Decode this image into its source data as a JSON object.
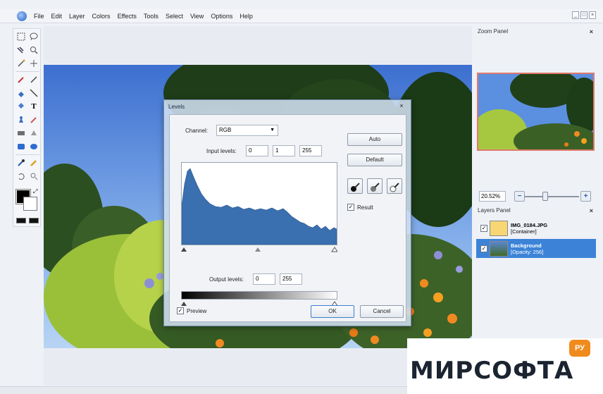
{
  "menu": {
    "items": [
      "File",
      "Edit",
      "Layer",
      "Colors",
      "Effects",
      "Tools",
      "Select",
      "View",
      "Options",
      "Help"
    ]
  },
  "window_controls": {
    "minimize": "_",
    "maximize": "□",
    "close": "×"
  },
  "zoom_panel": {
    "title": "Zoom Panel",
    "close": "×",
    "zoom_value": "20.52%",
    "zoom_out": "−",
    "zoom_in": "+",
    "zoom_level": 0.38
  },
  "layers_panel": {
    "title": "Layers Panel",
    "close": "×",
    "layers": [
      {
        "name": "IMG_0184.JPG",
        "sub": "[Container]",
        "checked": true
      },
      {
        "name": "Background",
        "sub": "[Opacity: 256]",
        "checked": true
      }
    ]
  },
  "levels": {
    "title": "Levels",
    "close": "×",
    "channel_label": "Channel:",
    "channel_value": "RGB",
    "input_label": "Input levels:",
    "input_values": [
      "0",
      "1",
      "255"
    ],
    "output_label": "Output levels:",
    "output_values": [
      "0",
      "255"
    ],
    "auto_label": "Auto",
    "default_label": "Default",
    "result_label": "Result",
    "result_checked": true,
    "preview_label": "Preview",
    "preview_checked": true,
    "ok_label": "OK",
    "cancel_label": "Cancel",
    "histogram_color": "#3a6fb0"
  },
  "watermark": {
    "text": "МИРСОФТА",
    "badge": "РУ",
    "badge_color": "#f18a1c"
  }
}
